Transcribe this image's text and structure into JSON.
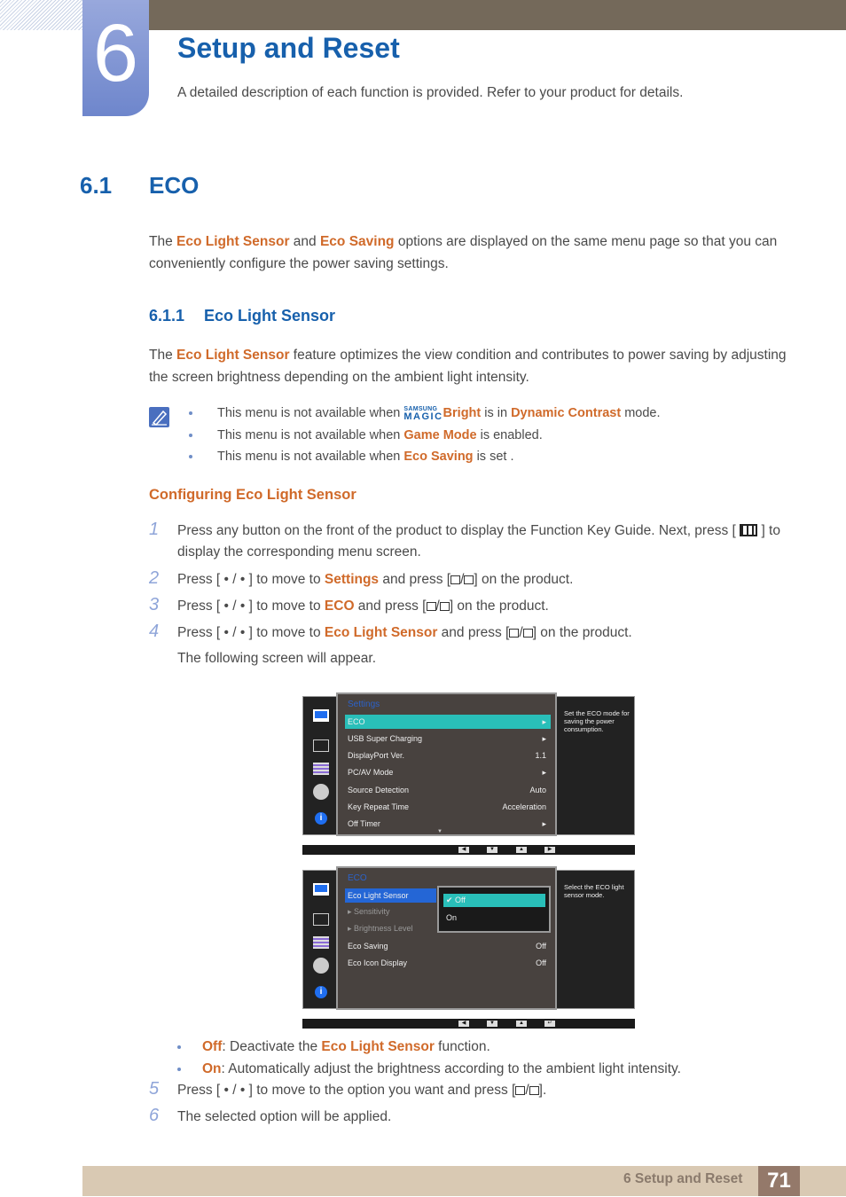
{
  "chapter": {
    "number": "6",
    "title": "Setup and Reset",
    "description": "A detailed description of each function is provided. Refer to your product for details."
  },
  "section": {
    "number": "6.1",
    "title": "ECO",
    "intro": {
      "p1": "The ",
      "hl1": "Eco Light Sensor",
      "p2": " and ",
      "hl2": "Eco Saving",
      "p3": " options are displayed on the same menu page so that you can conveniently configure the power saving settings."
    }
  },
  "subsection": {
    "number": "6.1.1",
    "title": "Eco Light Sensor",
    "intro": {
      "p1": "The ",
      "hl1": "Eco Light Sensor",
      "p2": " feature optimizes the view condition and contributes to power saving by adjusting the screen brightness depending on the ambient light intensity."
    }
  },
  "notes": [
    {
      "pre": "This menu is not available when ",
      "magic_top": "SAMSUNG",
      "magic_bottom": "MAGIC",
      "hl_a": "Bright",
      "mid": " is in ",
      "hl_b": "Dynamic Contrast",
      "post": " mode."
    },
    {
      "pre": "This menu is not available when ",
      "hl": "Game Mode",
      "post": " is enabled."
    },
    {
      "pre": "This menu is not available when ",
      "hl": "Eco Saving",
      "post": " is set ."
    }
  ],
  "configuring_heading": "Configuring Eco Light Sensor",
  "steps": [
    {
      "num": "1",
      "pre": "Press any button on the front of the product to display the Function Key Guide. Next, press [ ",
      "post": " ] to display the corresponding menu screen."
    },
    {
      "num": "2",
      "pre": "Press [ • / • ] to move to ",
      "hl": "Settings",
      "mid": " and press [",
      "post": "] on the product."
    },
    {
      "num": "3",
      "pre": "Press [ • / • ] to move to ",
      "hl": "ECO",
      "mid": " and press [",
      "post": "] on the product."
    },
    {
      "num": "4",
      "pre": "Press [ • / • ] to move to ",
      "hl": "Eco Light Sensor",
      "mid": " and press [",
      "post": "] on the product.",
      "follow": "The following screen will appear."
    },
    {
      "num": "5",
      "pre": "Press [ • / • ] to move to the option you want and press [",
      "post": "]."
    },
    {
      "num": "6",
      "pre": "The selected option will be applied."
    }
  ],
  "osd1": {
    "title": "Settings",
    "rows": [
      {
        "label": "ECO",
        "value": "▸"
      },
      {
        "label": "USB Super Charging",
        "value": "▸"
      },
      {
        "label": "DisplayPort Ver.",
        "value": "1.1"
      },
      {
        "label": "PC/AV Mode",
        "value": "▸"
      },
      {
        "label": "Source Detection",
        "value": "Auto"
      },
      {
        "label": "Key Repeat Time",
        "value": "Acceleration"
      },
      {
        "label": "Off Timer",
        "value": "▸"
      }
    ],
    "scroll": "▼",
    "help": "Set the ECO mode for saving the power consumption.",
    "keys": [
      "◀",
      "▼",
      "▲",
      "▶"
    ]
  },
  "osd2": {
    "title": "ECO",
    "rows": [
      {
        "label": "Eco Light Sensor",
        "value": ""
      },
      {
        "label": "▸ Sensitivity",
        "value": ""
      },
      {
        "label": "▸ Brightness Level",
        "value": ""
      },
      {
        "label": "Eco Saving",
        "value": "Off"
      },
      {
        "label": "Eco Icon Display",
        "value": "Off"
      }
    ],
    "options": [
      "✔ Off",
      "On"
    ],
    "help": "Select the ECO light sensor mode.",
    "keys": [
      "◀",
      "▼",
      "▲",
      "↵"
    ]
  },
  "option_desc": [
    {
      "hl": "Off",
      "pre": ": Deactivate the ",
      "hl2": "Eco Light Sensor",
      "post": " function."
    },
    {
      "hl": "On",
      "pre": ": Automatically adjust the brightness according to the ambient light intensity."
    }
  ],
  "footer": {
    "label": "6 Setup and Reset",
    "page": "71"
  }
}
